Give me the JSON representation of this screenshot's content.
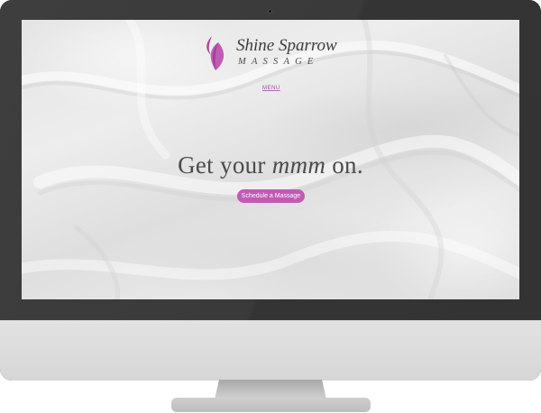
{
  "site": {
    "brand_name": "Shine Sparrow",
    "brand_subtitle": "MASSAGE",
    "menu_label": "MENU"
  },
  "hero": {
    "headline_prefix": "Get your ",
    "headline_emphasis": "mmm",
    "headline_suffix": " on.",
    "cta_label": "Schedule a Massage"
  },
  "colors": {
    "accent": "#c05bb3",
    "monitor_bezel": "#3a3a3a",
    "monitor_chin": "#dcdcdc",
    "text": "#4b4b4b"
  },
  "icons": {
    "logo": "flame-leaf-logo-icon"
  }
}
